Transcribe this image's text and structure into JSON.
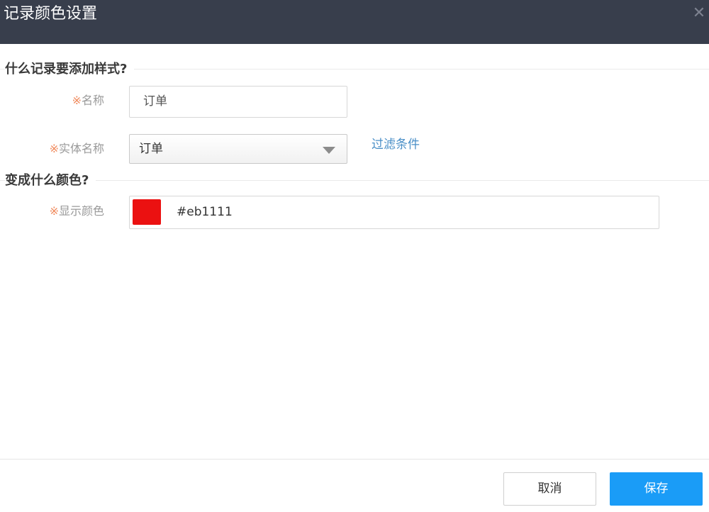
{
  "dialog": {
    "title": "记录颜色设置",
    "close_glyph": "✕"
  },
  "section_record": {
    "title": "什么记录要添加样式?",
    "name_field": {
      "required_mark": "※",
      "label": "名称",
      "value": "订单"
    },
    "entity_field": {
      "required_mark": "※",
      "label": "实体名称",
      "selected": "订单"
    },
    "filter_link": "过滤条件"
  },
  "section_color": {
    "title": "变成什么颜色?",
    "color_field": {
      "required_mark": "※",
      "label": "显示颜色",
      "value": "#eb1111"
    }
  },
  "footer": {
    "cancel_label": "取消",
    "save_label": "保存"
  },
  "colors": {
    "titlebar": "#383e4c",
    "primary": "#1a9cf7",
    "link": "#4a8fc7",
    "required": "#f08a5d"
  },
  "icons": {
    "close": "close-icon",
    "dropdown": "chevron-down-icon"
  }
}
